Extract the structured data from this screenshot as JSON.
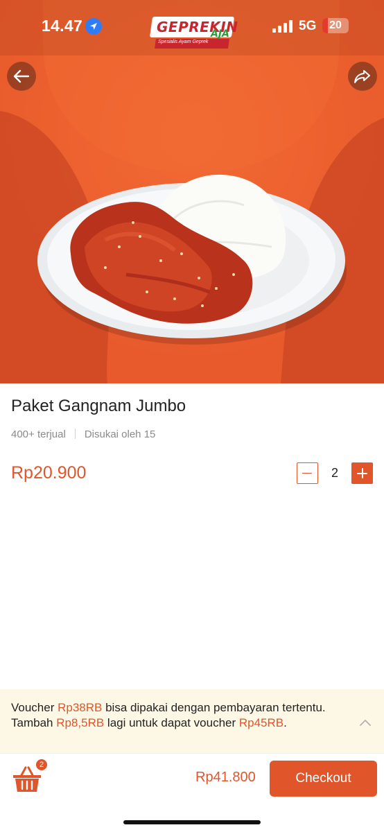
{
  "status_bar": {
    "time": "14.47",
    "network": "5G",
    "battery": "20",
    "battery_level": 0.2
  },
  "brand": {
    "logo_title": "GEPREKIN",
    "logo_accent": "AJA",
    "logo_tagline": "Spesialis Ayam Geprek"
  },
  "product": {
    "name": "Paket Gangnam Jumbo",
    "sold": "400+ terjual",
    "likes": "Disukai oleh 15",
    "price": "Rp20.900",
    "quantity": "2"
  },
  "voucher": {
    "part1": "Voucher ",
    "highlight1": "Rp38RB",
    "part2": " bisa dipakai dengan pembayaran tertentu. Tambah ",
    "highlight2": "Rp8,5RB",
    "part3": " lagi untuk dapat voucher ",
    "highlight3": "Rp45RB",
    "part4": "."
  },
  "cart": {
    "badge_count": "2",
    "total": "Rp41.800",
    "checkout_label": "Checkout"
  },
  "colors": {
    "accent": "#e0552a",
    "voucher_bg": "#fdf7e6"
  },
  "icons": [
    "location-arrow-icon",
    "signal-icon",
    "back-arrow-icon",
    "share-icon",
    "minus-icon",
    "plus-icon",
    "chevron-up-icon",
    "basket-icon"
  ]
}
